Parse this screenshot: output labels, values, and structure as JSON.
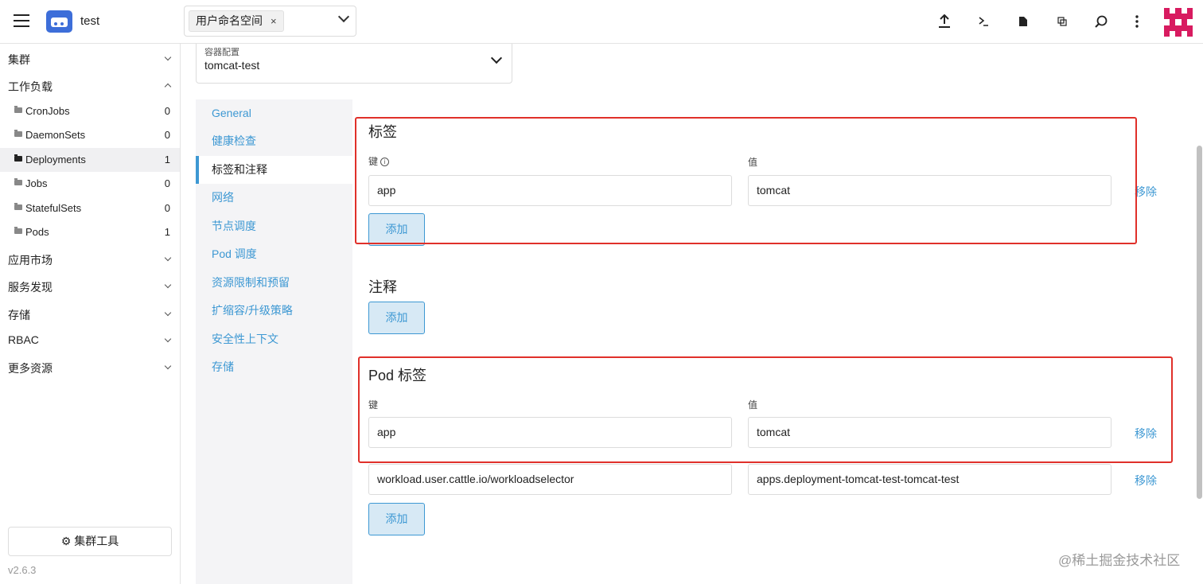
{
  "header": {
    "cluster_name": "test",
    "namespace_chip": "用户命名空间",
    "namespace_chip_remove": "×",
    "icons": [
      "upload-icon",
      "terminal-icon",
      "file-icon",
      "copy-icon",
      "search-icon",
      "more-icon",
      "user-avatar"
    ]
  },
  "sidebar": {
    "groups": [
      {
        "label": "集群",
        "expanded": false
      },
      {
        "label": "工作负载",
        "expanded": true
      },
      {
        "label": "应用市场",
        "expanded": false
      },
      {
        "label": "服务发现",
        "expanded": false
      },
      {
        "label": "存储",
        "expanded": false
      },
      {
        "label": "RBAC",
        "expanded": false
      },
      {
        "label": "更多资源",
        "expanded": false
      }
    ],
    "workload_items": [
      {
        "label": "CronJobs",
        "count": "0"
      },
      {
        "label": "DaemonSets",
        "count": "0"
      },
      {
        "label": "Deployments",
        "count": "1",
        "active": true
      },
      {
        "label": "Jobs",
        "count": "0"
      },
      {
        "label": "StatefulSets",
        "count": "0"
      },
      {
        "label": "Pods",
        "count": "1"
      }
    ],
    "tools_button": "集群工具",
    "version": "v2.6.3"
  },
  "container_select": {
    "label": "容器配置",
    "value": "tomcat-test"
  },
  "tabs": [
    {
      "label": "General"
    },
    {
      "label": "健康检查"
    },
    {
      "label": "标签和注释",
      "active": true
    },
    {
      "label": "网络"
    },
    {
      "label": "节点调度"
    },
    {
      "label": "Pod 调度"
    },
    {
      "label": "资源限制和预留"
    },
    {
      "label": "扩缩容/升级策略"
    },
    {
      "label": "安全性上下文"
    },
    {
      "label": "存储"
    }
  ],
  "labels_section": {
    "title": "标签",
    "key_label": "键",
    "value_label": "值",
    "rows": [
      {
        "key": "app",
        "value": "tomcat",
        "remove": "移除"
      }
    ],
    "add_button": "添加"
  },
  "annotations_section": {
    "title": "注释",
    "add_button": "添加"
  },
  "pod_labels_section": {
    "title": "Pod 标签",
    "key_label": "键",
    "value_label": "值",
    "rows": [
      {
        "key": "app",
        "value": "tomcat",
        "remove": "移除"
      },
      {
        "key": "workload.user.cattle.io/workloadselector",
        "value": "apps.deployment-tomcat-test-tomcat-test",
        "remove": "移除"
      }
    ],
    "add_button": "添加"
  },
  "highlight_color": "#e0302a",
  "accent_color": "#3d98d3",
  "watermark": "@稀土掘金技术社区"
}
